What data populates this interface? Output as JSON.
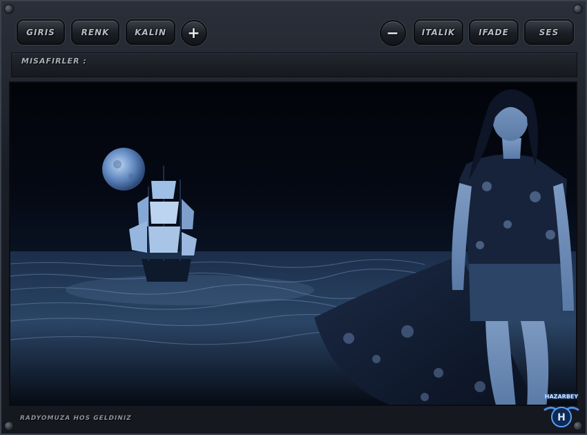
{
  "toolbar": {
    "left_buttons": [
      "GIRIS",
      "RENK",
      "KALIN"
    ],
    "plus_label": "+",
    "minus_label": "−",
    "right_buttons": [
      "ITALIK",
      "IFADE",
      "SES"
    ]
  },
  "guests": {
    "label": "MISAFIRLER :"
  },
  "footer": {
    "welcome": "RADYOMUZA HOS GELDINIZ"
  },
  "badge": {
    "brand": "HAZARBEY",
    "mark": "H"
  },
  "colors": {
    "accent_blue": "#6aa8ff",
    "panel": "#1a1e26",
    "button_text": "#b8bcc4"
  }
}
